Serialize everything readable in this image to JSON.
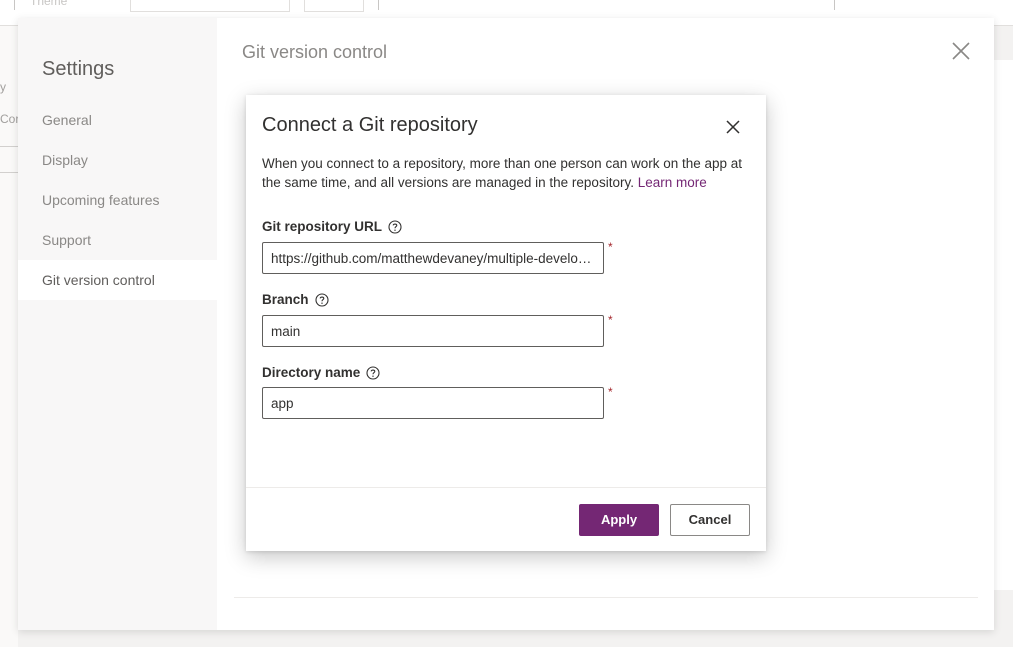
{
  "background_app": {
    "toolbar_fragment": "Theme",
    "sidebar_fragments": [
      "y",
      "Cor"
    ]
  },
  "settings": {
    "title": "Settings",
    "heading": "Git version control",
    "nav": [
      {
        "label": "General",
        "active": false
      },
      {
        "label": "Display",
        "active": false
      },
      {
        "label": "Upcoming features",
        "active": false
      },
      {
        "label": "Support",
        "active": false
      },
      {
        "label": "Git version control",
        "active": true
      }
    ]
  },
  "dialog": {
    "title": "Connect a Git repository",
    "description": "When you connect to a repository, more than one person can work on the app at the same time, and all versions are managed in the repository.",
    "learn_more": "Learn more",
    "fields": {
      "repo_url": {
        "label": "Git repository URL",
        "value": "https://github.com/matthewdevaney/multiple-developers",
        "required": "*"
      },
      "branch": {
        "label": "Branch",
        "value": "main",
        "required": "*"
      },
      "directory": {
        "label": "Directory name",
        "value": "app",
        "required": "*"
      }
    },
    "apply_label": "Apply",
    "cancel_label": "Cancel"
  },
  "colors": {
    "accent": "#742774",
    "required": "#a4262c",
    "overlay": "#f3f2f1"
  },
  "icons": {
    "close": "close-icon",
    "help": "help-icon"
  }
}
